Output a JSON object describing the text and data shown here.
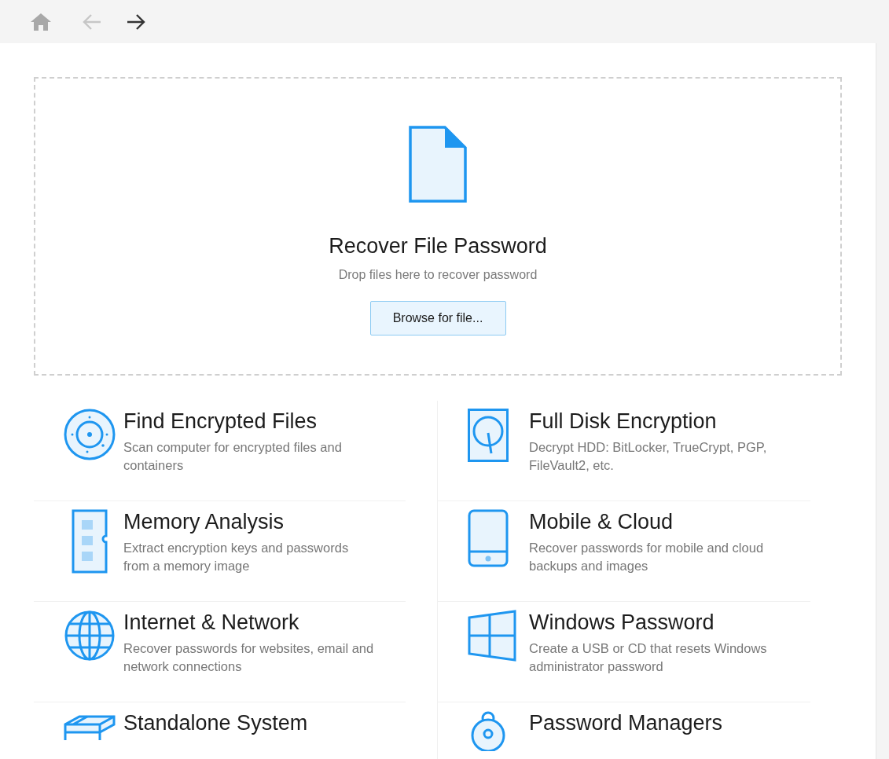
{
  "nav": [
    {
      "kind": "home"
    },
    {
      "kind": "back",
      "disabled": true
    },
    {
      "kind": "forward",
      "disabled": false
    }
  ],
  "drop_zone": {
    "title": "Recover File Password",
    "subtitle": "Drop files here to recover password",
    "button": "Browse for file..."
  },
  "tools": [
    {
      "kind": "disc",
      "title": "Find Encrypted Files",
      "description": "Scan computer for encrypted files and containers"
    },
    {
      "kind": "disk",
      "title": "Full Disk Encryption",
      "description": "Decrypt HDD: BitLocker, TrueCrypt, PGP, FileVault2, etc."
    },
    {
      "kind": "memory",
      "title": "Memory Analysis",
      "description": "Extract encryption keys and passwords from a memory image"
    },
    {
      "kind": "mobile",
      "title": "Mobile & Cloud",
      "description": "Recover passwords for mobile and cloud backups and images"
    },
    {
      "kind": "globe",
      "title": "Internet & Network",
      "description": "Recover passwords for websites, email and network connections"
    },
    {
      "kind": "windows",
      "title": "Windows Password",
      "description": "Create a USB or CD that resets Windows administrator password"
    },
    {
      "kind": "boxes",
      "title": "Standalone System"
    },
    {
      "kind": "lock",
      "title": "Password Managers"
    }
  ]
}
